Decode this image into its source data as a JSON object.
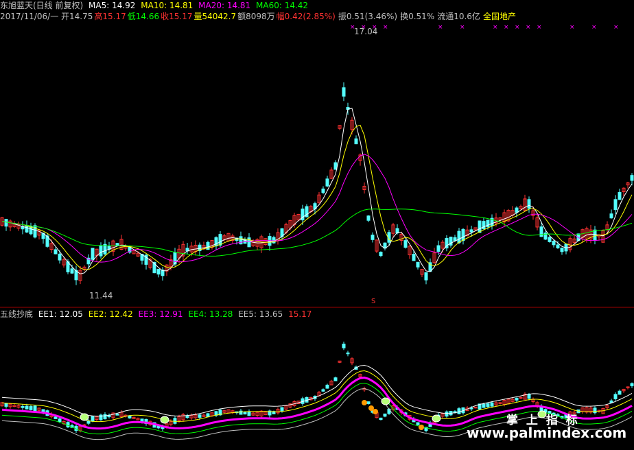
{
  "main_chart": {
    "header": {
      "title": "东旭蓝天(日线 前复权)",
      "ma5": "MA5: 14.92",
      "ma10": "MA10: 14.81",
      "ma20": "MA20: 14.81",
      "ma60": "MA60: 14.42"
    },
    "info": {
      "date_open": "2017/11/06/一 开14.75",
      "high": "高15.17",
      "low": "低14.66",
      "close": "收15.17",
      "volume": "量54042.7",
      "amount": "额8098万",
      "change": "幅0.42(2.85%)",
      "amplitude": "振0.51(3.46%)",
      "turnover": "换0.51%",
      "float_cap": "流通10.6亿",
      "sector": "全国地产"
    },
    "high_label": "17.04",
    "low_label": "11.44",
    "signal_mark": "S"
  },
  "indicator": {
    "name": "五线抄底",
    "ee1": "EE1: 12.05",
    "ee2": "EE2: 12.42",
    "ee3": "EE3: 12.91",
    "ee4": "EE4: 13.28",
    "ee5": "EE5: 13.65",
    "value": "15.17"
  },
  "watermark": {
    "top": "掌 上 指 标",
    "bottom": "www.palmindex.com"
  },
  "colors": {
    "up": "#ff3232",
    "down": "#54ffff",
    "ma5": "#ffffff",
    "ma10": "#ffff00",
    "ma20": "#ff00ff",
    "ma60": "#00ff00",
    "ee_main": "#ff00ff"
  }
}
